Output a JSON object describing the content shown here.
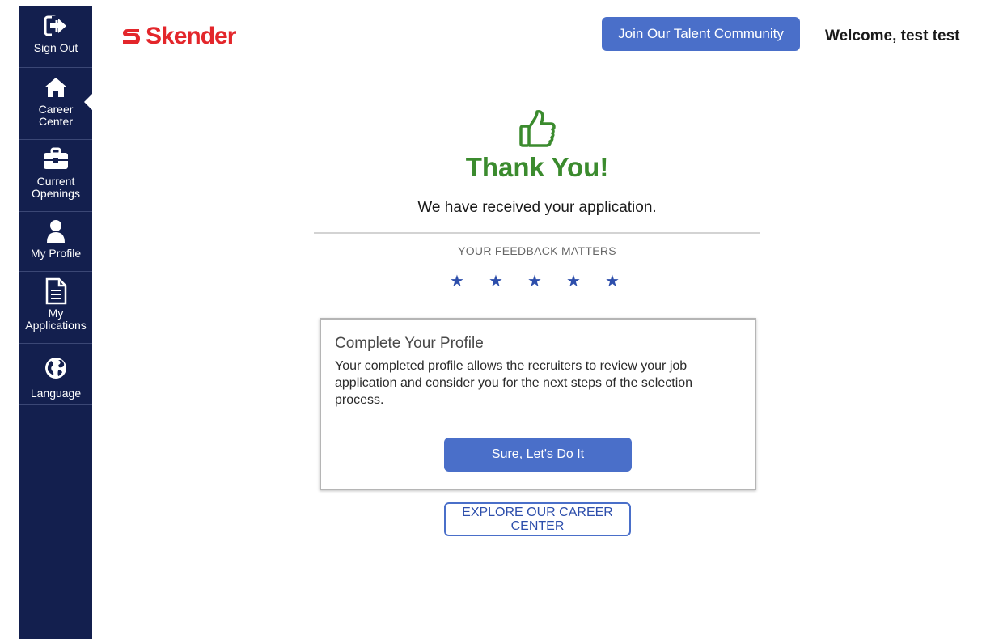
{
  "sidebar": {
    "items": [
      {
        "label": "Sign Out",
        "icon": "sign-out-icon"
      },
      {
        "label": "Career Center",
        "icon": "home-icon"
      },
      {
        "label": "Current Openings",
        "icon": "briefcase-icon"
      },
      {
        "label": "My Profile",
        "icon": "user-icon"
      },
      {
        "label": "My Applications",
        "icon": "document-icon"
      },
      {
        "label": "Language",
        "icon": "globe-icon"
      }
    ],
    "active_index": 1
  },
  "header": {
    "logo_text": "Skender",
    "talent_button": "Join Our Talent Community",
    "welcome": "Welcome, test test"
  },
  "main": {
    "title": "Thank You!",
    "subtitle": "We have received your application.",
    "feedback_label": "YOUR FEEDBACK MATTERS",
    "star_count": 5,
    "card": {
      "title": "Complete Your Profile",
      "body": "Your completed profile allows the recruiters to review your job application and consider you for the next steps of the selection process.",
      "button": "Sure, Let's Do It"
    },
    "explore_button": "EXPLORE OUR CAREER CENTER"
  },
  "colors": {
    "sidebar_bg": "#131f4e",
    "accent": "#4a6fc9",
    "brand_red": "#e3262b",
    "success_green": "#3b8b2e",
    "star_blue": "#2d4eab"
  }
}
